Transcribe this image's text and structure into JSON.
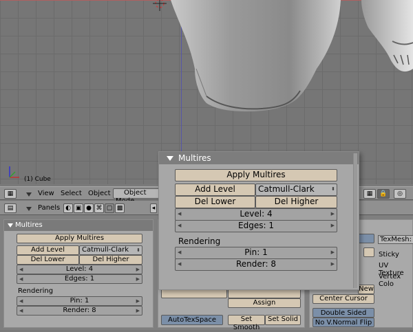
{
  "viewport": {
    "object_label": "(1) Cube"
  },
  "view_header": {
    "menus": [
      "View",
      "Select",
      "Object"
    ],
    "mode_label": "Object Mode"
  },
  "buttons_header": {
    "panels_label": "Panels"
  },
  "multires_panel": {
    "title": "Multires",
    "apply_label": "Apply Multires",
    "add_level_label": "Add Level",
    "subdiv_type": "Catmull-Clark",
    "del_lower_label": "Del Lower",
    "del_higher_label": "Del Higher",
    "level_text": "Level: 4",
    "edges_text": "Edges: 1",
    "rendering_label": "Rendering",
    "pin_text": "Pin: 1",
    "render_text": "Render: 8"
  },
  "popup_panel": {
    "title": "Multires",
    "apply_label": "Apply Multires",
    "add_level_label": "Add Level",
    "subdiv_type": "Catmull-Clark",
    "del_lower_label": "Del Lower",
    "del_higher_label": "Del Higher",
    "level_text": "Level: 4",
    "edges_text": "Edges: 1",
    "rendering_label": "Rendering",
    "pin_text": "Pin: 1",
    "render_text": "Render: 8"
  },
  "link_panel": {
    "assign_label": "Assign",
    "autotexspace_label": "AutoTexSpace",
    "set_smooth_label": "Set Smooth",
    "set_solid_label": "Set Solid"
  },
  "mesh_panel": {
    "new_label": "New",
    "center_cursor_label": "Center Cursor",
    "double_sided_label": "Double Sided",
    "no_v_normal_flip_label": "No V.Normal Flip",
    "texmesh_label": "TexMesh:",
    "sticky_label": "Sticky",
    "uv_texture_label": "UV Texture",
    "vertex_colors_label": "Vertex Colo"
  },
  "colors": {
    "button": "#d5c8b3",
    "numfield": "#a3a3a3",
    "panel": "#a9a9a9",
    "viewport": "#767676",
    "toggle_on": "#7b8fa8"
  }
}
